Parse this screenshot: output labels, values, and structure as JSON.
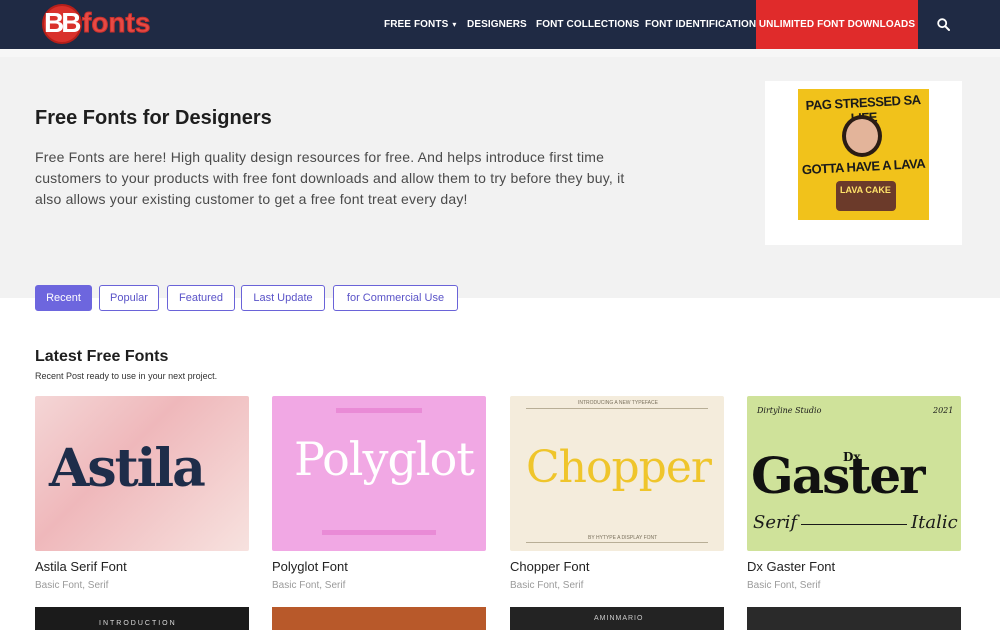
{
  "nav": {
    "logo_mark": "BB",
    "logo_text": "fonts",
    "items": [
      {
        "label": "FREE FONTS",
        "chevron": "▾"
      },
      {
        "label": "DESIGNERS"
      },
      {
        "label": "FONT COLLECTIONS"
      },
      {
        "label": "FONT IDENTIFICATION"
      },
      {
        "label": "UNLIMITED FONT DOWNLOADS"
      }
    ],
    "search_icon": "search-icon",
    "accent_color": "#e02b2b",
    "bar_color": "#1f2a44"
  },
  "hero": {
    "title": "Free Fonts for Designers",
    "description": "Free Fonts are here! High quality design resources for free. And helps introduce first time customers to your products with free font downloads and allow them to try before they buy, it also allows your existing customer to get a free font treat every day!",
    "ad": {
      "line1": "PAG STRESSED SA LIFE",
      "line2": "GOTTA HAVE A LAVA",
      "product": "LAVA CAKE"
    }
  },
  "tabs": [
    {
      "label": "Recent",
      "active": true
    },
    {
      "label": "Popular",
      "active": false
    },
    {
      "label": "Featured",
      "active": false
    },
    {
      "label": "Last Update",
      "active": false
    },
    {
      "label": "for Commercial Use",
      "active": false
    }
  ],
  "section": {
    "title": "Latest Free Fonts",
    "subtitle": "Recent Post ready to use in your next project."
  },
  "cards": [
    {
      "title": "Astila Serif Font",
      "category": "Basic Font, Serif",
      "preview": "Astila"
    },
    {
      "title": "Polyglot Font",
      "category": "Basic Font, Serif",
      "preview": "Polyglot"
    },
    {
      "title": "Chopper Font",
      "category": "Basic Font, Serif",
      "preview": "Chopper",
      "top_text": "INTRODUCING A NEW TYPEFACE",
      "bottom_text": "BY HYTYPE A DISPLAY FONT"
    },
    {
      "title": "Dx Gaster Font",
      "category": "Basic Font, Serif",
      "preview": "Gaster",
      "studio": "Dirtyline Studio",
      "year": "2021",
      "prefix": "Dx",
      "left_word": "Serif",
      "right_word": "Italic"
    }
  ],
  "peeks": {
    "first": "INTRODUCTION",
    "third": "AMINMARIO"
  }
}
